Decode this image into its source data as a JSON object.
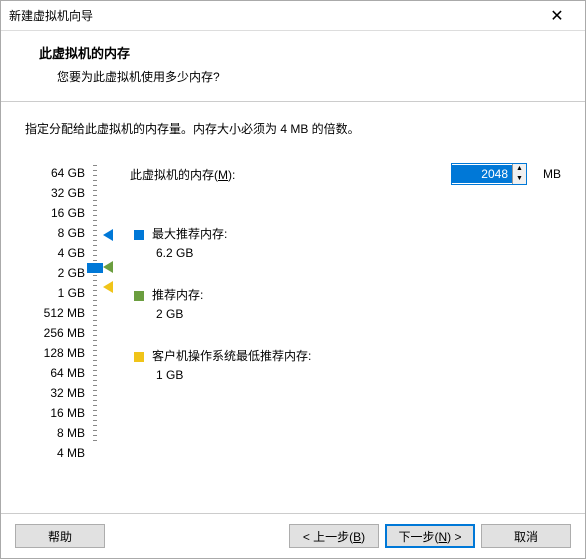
{
  "window": {
    "title": "新建虚拟机向导"
  },
  "header": {
    "title": "此虚拟机的内存",
    "subtitle": "您要为此虚拟机使用多少内存?"
  },
  "instruction": "指定分配给此虚拟机的内存量。内存大小必须为 4 MB 的倍数。",
  "input": {
    "label_pre": "此虚拟机的内存(",
    "label_key": "M",
    "label_post": "):",
    "value": "2048",
    "unit": "MB"
  },
  "ticks": [
    "64 GB",
    "32 GB",
    "16 GB",
    "8 GB",
    "4 GB",
    "2 GB",
    "1 GB",
    "512 MB",
    "256 MB",
    "128 MB",
    "64 MB",
    "32 MB",
    "16 MB",
    "8 MB",
    "4 MB"
  ],
  "recommendations": {
    "max": {
      "label": "最大推荐内存:",
      "value": "6.2 GB"
    },
    "rec": {
      "label": "推荐内存:",
      "value": "2 GB"
    },
    "min": {
      "label": "客户机操作系统最低推荐内存:",
      "value": "1 GB"
    }
  },
  "buttons": {
    "help": "帮助",
    "back_pre": "< 上一步(",
    "back_key": "B",
    "back_post": ")",
    "next_pre": "下一步(",
    "next_key": "N",
    "next_post": ") >",
    "cancel": "取消"
  }
}
